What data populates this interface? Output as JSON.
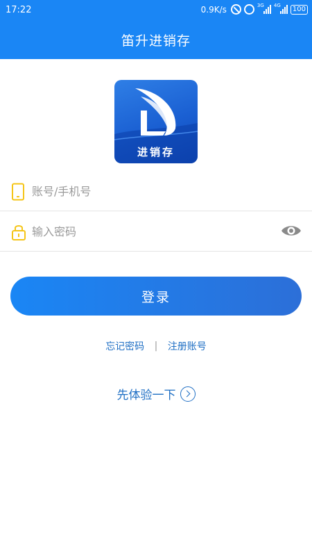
{
  "status_bar": {
    "time": "17:22",
    "net_speed": "0.9K/s",
    "signal1_label": "3G",
    "signal2_label": "4G",
    "battery": "100"
  },
  "header": {
    "title": "笛升进销存"
  },
  "logo": {
    "caption": "进销存",
    "icon": "app-logo"
  },
  "form": {
    "account": {
      "placeholder": "账号/手机号",
      "value": "",
      "icon": "phone-icon"
    },
    "password": {
      "placeholder": "输入密码",
      "value": "",
      "icon": "lock-icon",
      "toggle_icon": "eye-icon"
    },
    "login_label": "登录"
  },
  "links": {
    "forgot_password": "忘记密码",
    "separator": "|",
    "register": "注册账号"
  },
  "trial": {
    "label": "先体验一下",
    "icon": "chevron-right-circle-icon"
  },
  "colors": {
    "primary": "#1a86f5",
    "link": "#1f6fc4",
    "icon_yellow": "#f5c518"
  }
}
